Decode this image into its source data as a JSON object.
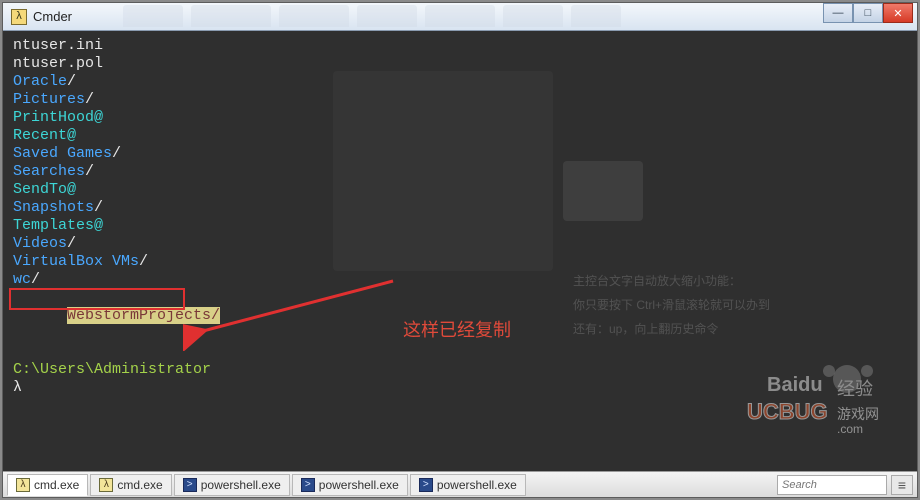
{
  "window": {
    "title": "Cmder",
    "icon_glyph": "λ"
  },
  "window_buttons": {
    "minimize": "—",
    "maximize": "□",
    "close": "✕"
  },
  "bg_tabs": [
    "…",
    "…",
    "…",
    "…",
    "…",
    "…",
    "…"
  ],
  "listing": [
    {
      "name": "ntuser.ini",
      "suffix": "",
      "color": "white"
    },
    {
      "name": "ntuser.pol",
      "suffix": "",
      "color": "white"
    },
    {
      "name": "Oracle",
      "suffix": "/",
      "color": "blue"
    },
    {
      "name": "Pictures",
      "suffix": "/",
      "color": "blue"
    },
    {
      "name": "PrintHood",
      "suffix": "@",
      "color": "cyan"
    },
    {
      "name": "Recent",
      "suffix": "@",
      "color": "cyan"
    },
    {
      "name": "Saved Games",
      "suffix": "/",
      "color": "blue"
    },
    {
      "name": "Searches",
      "suffix": "/",
      "color": "blue"
    },
    {
      "name": "SendTo",
      "suffix": "@",
      "color": "cyan"
    },
    {
      "name": "Snapshots",
      "suffix": "/",
      "color": "blue"
    },
    {
      "name": "Templates",
      "suffix": "@",
      "color": "cyan"
    },
    {
      "name": "Videos",
      "suffix": "/",
      "color": "blue"
    },
    {
      "name": "VirtualBox VMs",
      "suffix": "/",
      "color": "blue"
    },
    {
      "name": "wc",
      "suffix": "/",
      "color": "blue"
    }
  ],
  "selected_line": {
    "name": "WebstormProjects",
    "suffix": "/"
  },
  "prompt": {
    "cwd": "C:\\Users\\Administrator",
    "symbol": "λ"
  },
  "annotation": {
    "text": "这样已经复制"
  },
  "ghost_hints": {
    "line1": "主控台文字自动放大缩小功能：",
    "line2": "你只要按下 Ctrl+滑鼠滚轮就可以办到",
    "line3": "还有：up，向上翻历史命令"
  },
  "watermark": {
    "brand1": "Baidu 经验",
    "brand2": "UCBUG 游戏网",
    "dotcom": ".com"
  },
  "tabs": [
    {
      "icon": "lam",
      "glyph": "λ",
      "label": "cmd.exe",
      "active": true
    },
    {
      "icon": "lam",
      "glyph": "λ",
      "label": "cmd.exe",
      "active": false
    },
    {
      "icon": "ps",
      "glyph": ">",
      "label": "powershell.exe",
      "active": false
    },
    {
      "icon": "ps",
      "glyph": ">",
      "label": "powershell.exe",
      "active": false
    },
    {
      "icon": "ps",
      "glyph": ">",
      "label": "powershell.exe",
      "active": false
    }
  ],
  "search_placeholder": "Search",
  "menu_glyph": "≡"
}
